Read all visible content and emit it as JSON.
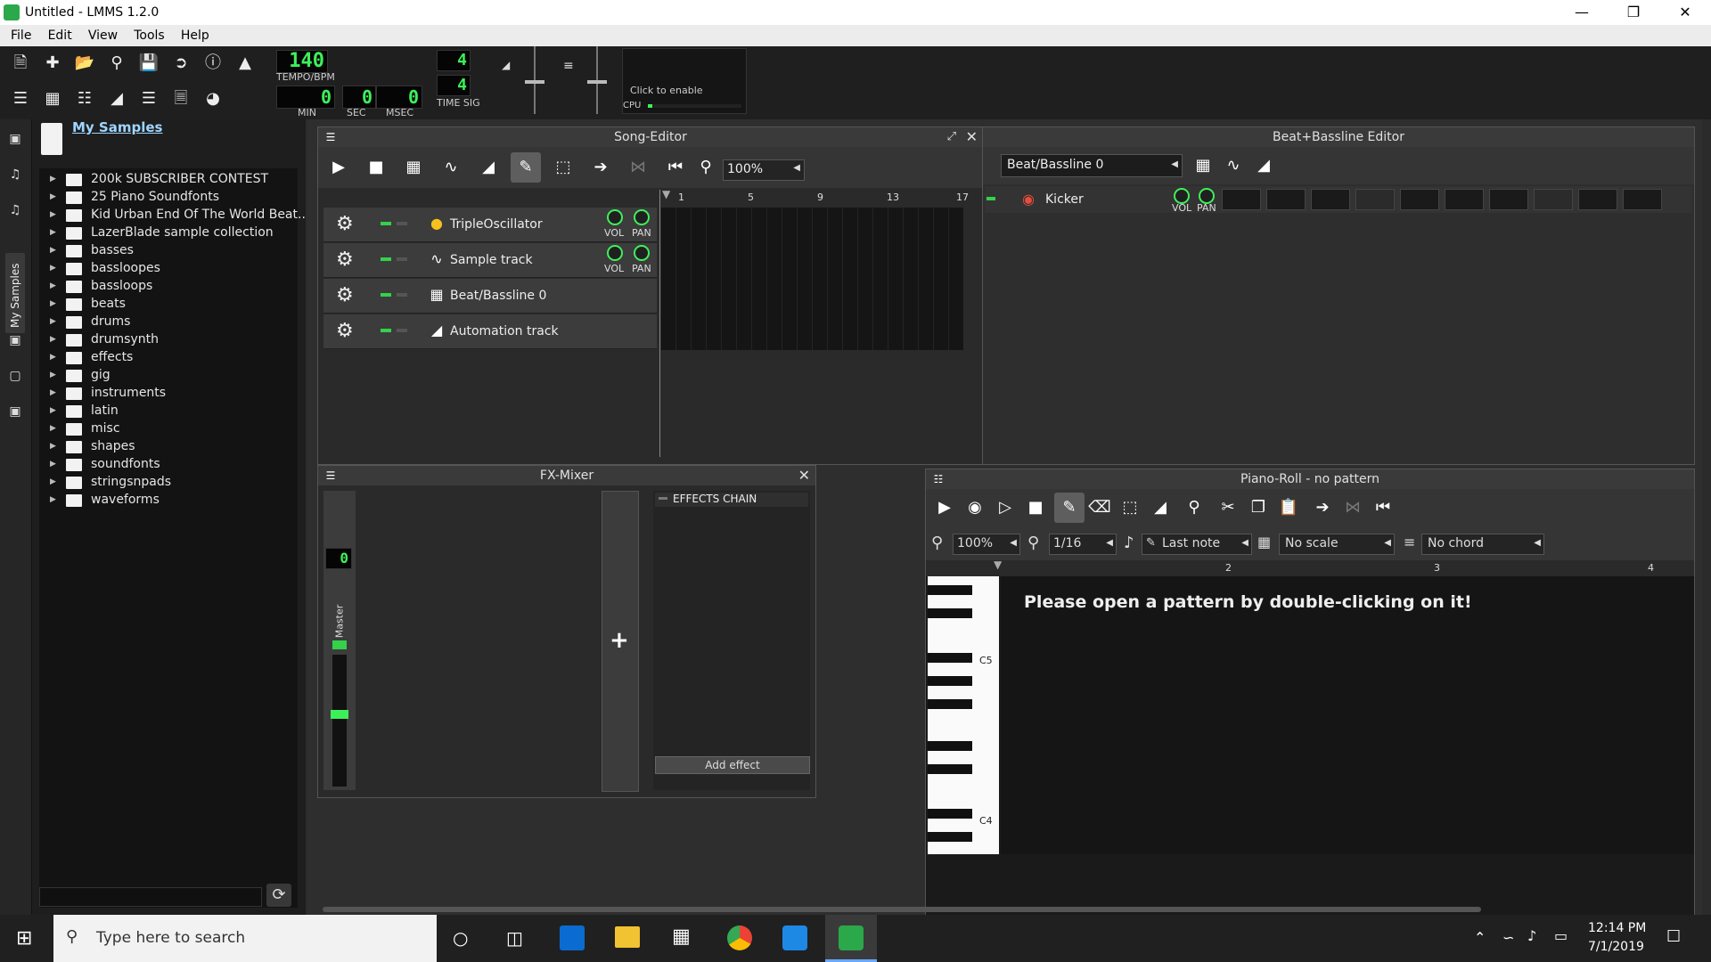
{
  "window": {
    "title": "Untitled - LMMS 1.2.0"
  },
  "menu": [
    "File",
    "Edit",
    "View",
    "Tools",
    "Help"
  ],
  "toolbar": {
    "tempo": "140",
    "tempo_label": "TEMPO/BPM",
    "min": "0",
    "min_label": "MIN",
    "sec": "0",
    "sec_label": "SEC",
    "msec": "0",
    "msec_label": "MSEC",
    "timesig_num": "4",
    "timesig_den": "4",
    "timesig_label": "TIME SIG",
    "cpu_hint": "Click to enable",
    "cpu_label": "CPU"
  },
  "sidebar": {
    "tab_label": "My Samples"
  },
  "browser": {
    "title": "My Samples",
    "folders": [
      "200k SUBSCRIBER CONTEST",
      "25 Piano Soundfonts",
      "Kid Urban End Of The World Beat...",
      "LazerBlade sample collection",
      "basses",
      "bassloopes",
      "bassloops",
      "beats",
      "drums",
      "drumsynth",
      "effects",
      "gig",
      "instruments",
      "latin",
      "misc",
      "shapes",
      "soundfonts",
      "stringsnpads",
      "waveforms"
    ]
  },
  "song_editor": {
    "title": "Song-Editor",
    "zoom": "100%",
    "ruler": [
      "1",
      "5",
      "9",
      "13",
      "17"
    ],
    "tracks": [
      {
        "name": "TripleOscillator",
        "vol": "VOL",
        "pan": "PAN"
      },
      {
        "name": "Sample track",
        "vol": "VOL",
        "pan": "PAN"
      },
      {
        "name": "Beat/Bassline 0"
      },
      {
        "name": "Automation track"
      }
    ]
  },
  "bb_editor": {
    "title": "Beat+Bassline Editor",
    "selector": "Beat/Bassline 0",
    "track_name": "Kicker",
    "vol": "VOL",
    "pan": "PAN"
  },
  "fx_mixer": {
    "title": "FX-Mixer",
    "master_label": "Master",
    "master_level": "0",
    "effects_chain": "EFFECTS CHAIN",
    "add_effect": "Add effect",
    "add_channel": "+"
  },
  "piano_roll": {
    "title": "Piano-Roll - no pattern",
    "zoom": "100%",
    "quantize": "1/16",
    "note_len": "Last note",
    "scale": "No scale",
    "chord": "No chord",
    "ruler": [
      "2",
      "3",
      "4"
    ],
    "message": "Please open a pattern by double-clicking on it!",
    "key_c5": "C5",
    "key_c4": "C4"
  },
  "taskbar": {
    "search_placeholder": "Type here to search",
    "time": "12:14 PM",
    "date": "7/1/2019"
  }
}
